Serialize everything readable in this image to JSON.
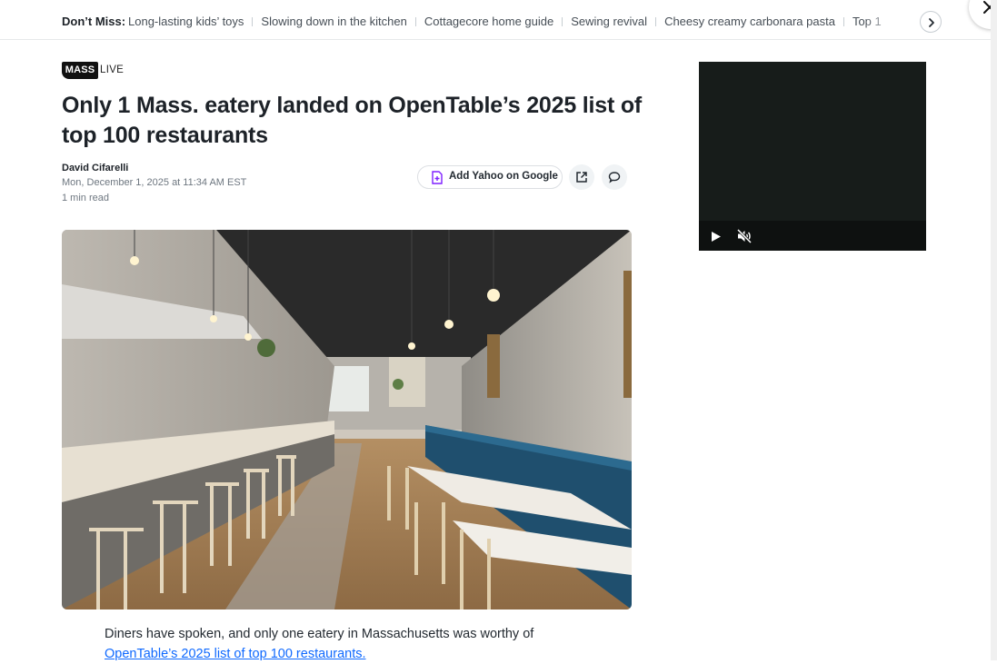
{
  "dont_miss": {
    "label": "Don’t Miss:",
    "items": [
      "Long-lasting kids’ toys",
      "Slowing down in the kitchen",
      "Cottagecore home guide",
      "Sewing revival",
      "Cheesy creamy carbonara pasta",
      "Top 1"
    ],
    "next_icon": "chevron-right-icon"
  },
  "close_icon": "close-icon",
  "article": {
    "logo": {
      "main": "MASS",
      "sub": "LIVE"
    },
    "headline": "Only 1 Mass. eatery landed on OpenTable’s 2025 list of top 100 restaurants",
    "author": "David Cifarelli",
    "date": "Mon, December 1, 2025 at 11:34 AM EST",
    "read_time": "1 min read",
    "actions": {
      "add_yahoo": "Add Yahoo on Google",
      "share_icon": "share-icon",
      "comment_icon": "comment-icon"
    },
    "hero_image_alt": "restaurant-interior-photo",
    "body_line1": "Diners have spoken, and only one eatery in Massachusetts was worthy of",
    "body_link": "OpenTable’s 2025 list of top 100 restaurants."
  },
  "video": {
    "play_icon": "play-icon",
    "mute_icon": "muted-speaker-icon"
  },
  "colors": {
    "accent_link": "#0f69ff",
    "text_primary": "#1d2228",
    "text_secondary": "#6e7780",
    "yahoo_purple": "#7e1fff"
  }
}
